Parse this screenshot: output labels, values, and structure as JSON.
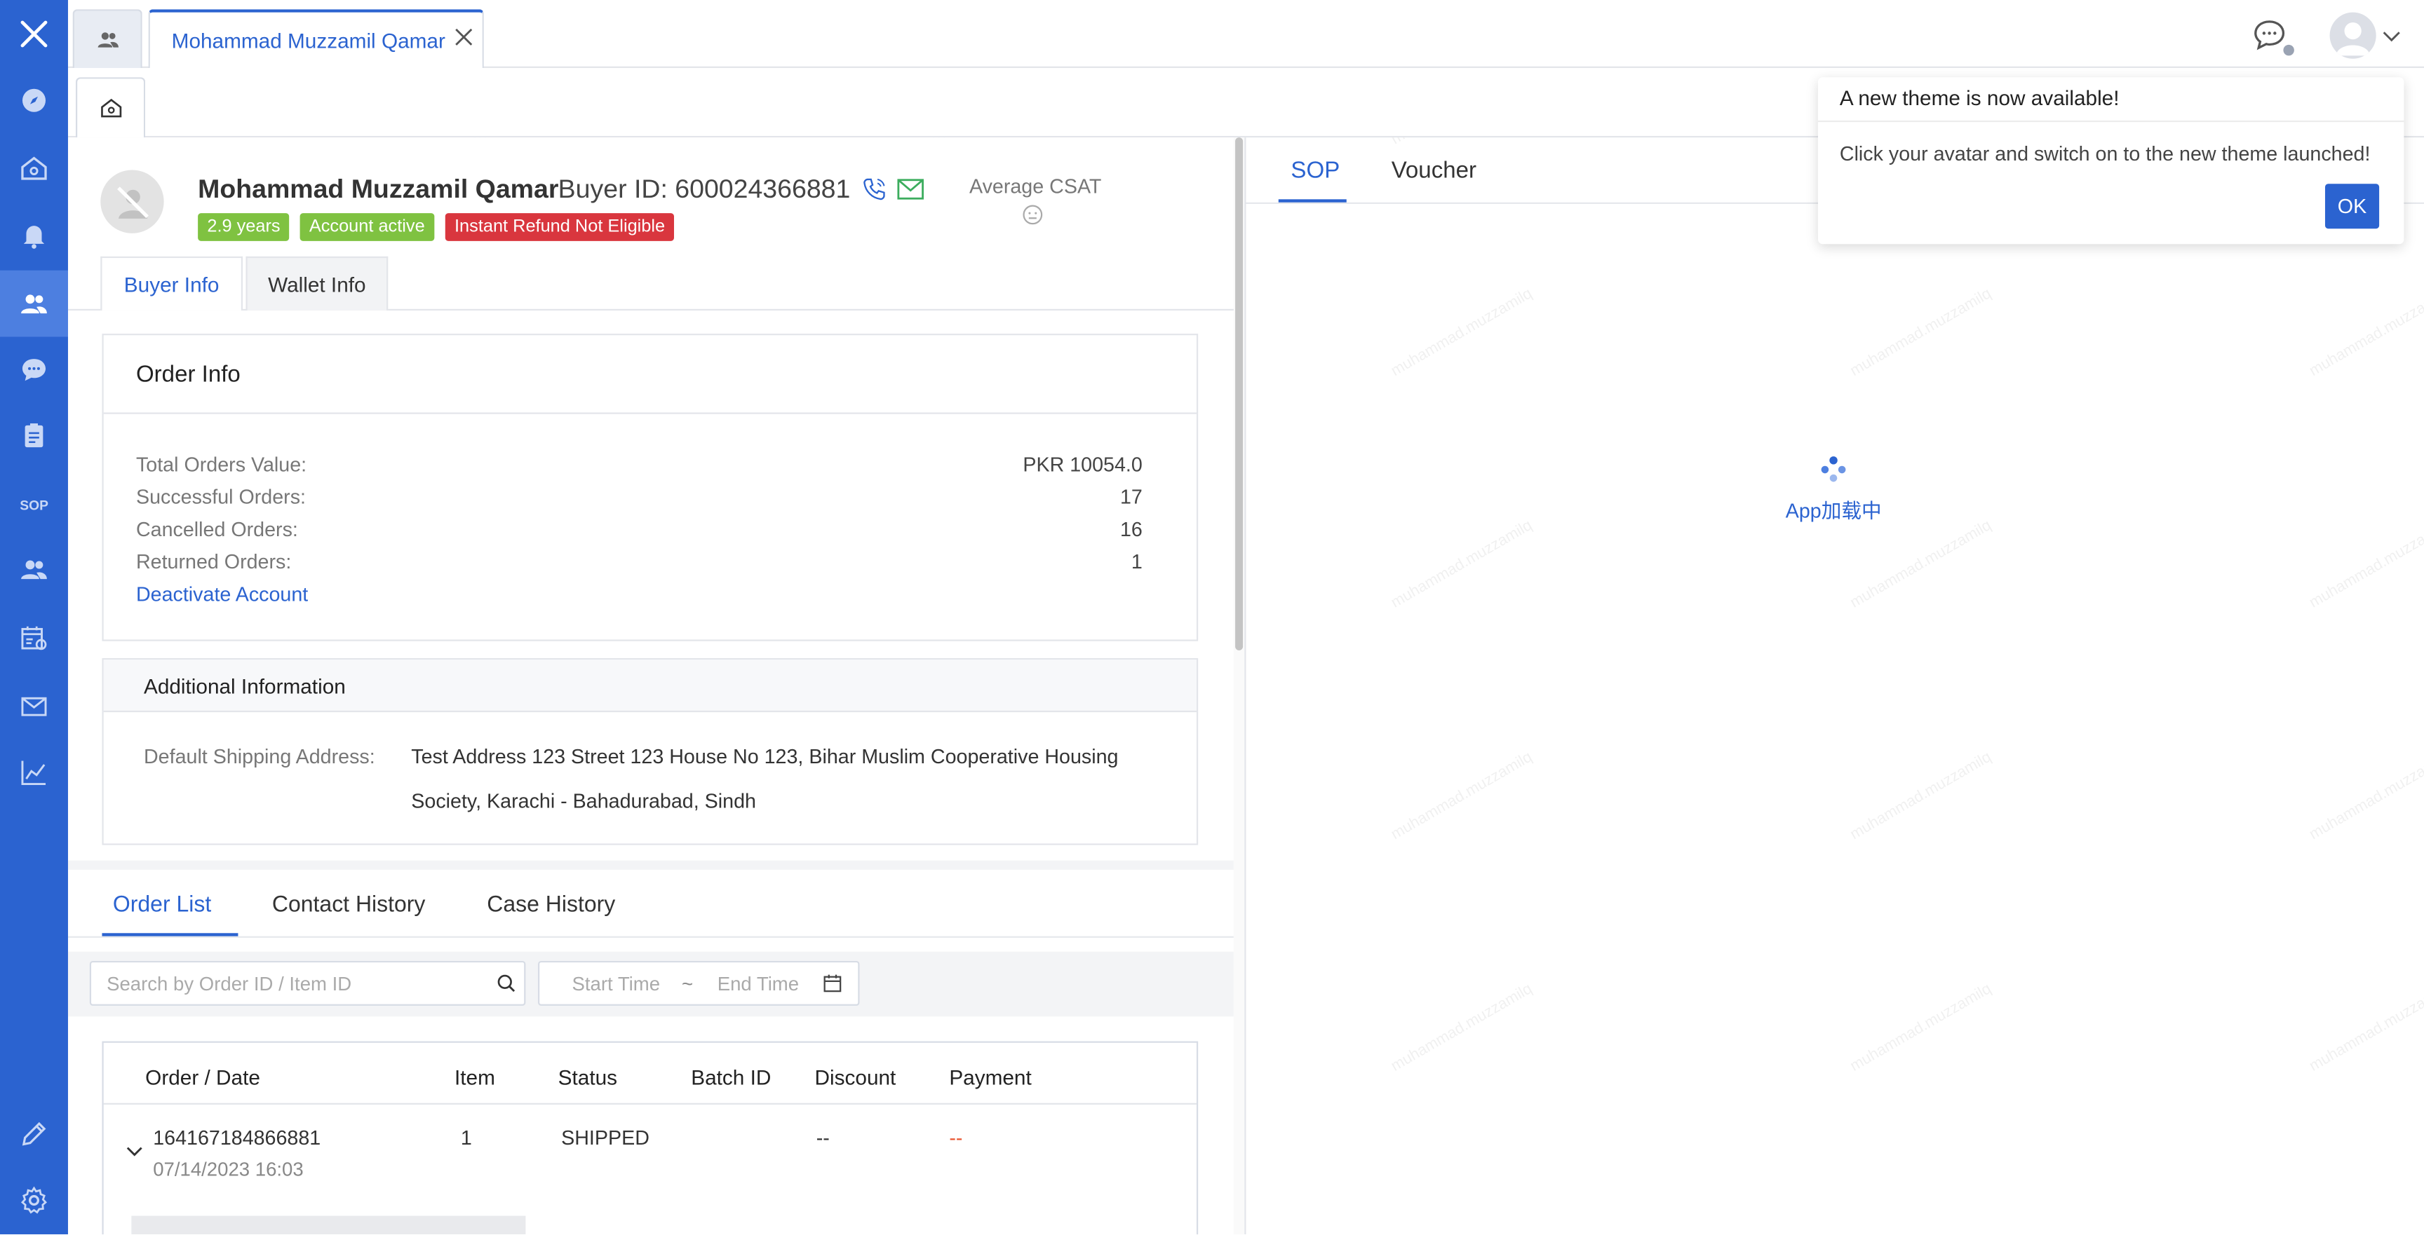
{
  "tabs": {
    "buyer_tab_label": "Mohammad Muzzamil Qamar",
    "buyer_tab_close": "X"
  },
  "profile": {
    "name": "Mohammad Muzzamil Qamar",
    "buyer_id": "Buyer ID: 600024366881",
    "csat_label": "Average CSAT",
    "badges": [
      "2.9 years",
      "Account active",
      "Instant Refund Not Eligible"
    ],
    "badge_colors": [
      "#7fc241",
      "#7fc241",
      "#d9363e"
    ]
  },
  "info_tabs": [
    "Buyer Info",
    "Wallet Info"
  ],
  "order_info": {
    "title": "Order Info",
    "rows": [
      {
        "label": "Total Orders Value:",
        "value": "PKR 10054.0"
      },
      {
        "label": "Successful Orders:",
        "value": "17"
      },
      {
        "label": "Cancelled Orders:",
        "value": "16"
      },
      {
        "label": "Returned Orders:",
        "value": "1"
      }
    ],
    "deactivate_link": "Deactivate Account"
  },
  "additional_info": {
    "title": "Additional Information",
    "address_label": "Default Shipping Address:",
    "address_line1": "Test Address 123 Street 123 House No 123, Bihar Muslim Cooperative Housing",
    "address_line2": "Society, Karachi - Bahadurabad, Sindh"
  },
  "order_tabs": [
    "Order List",
    "Contact History",
    "Case History"
  ],
  "search": {
    "placeholder": "Search by Order ID / Item ID",
    "start_time": "Start Time",
    "separator": "~",
    "end_time": "End Time"
  },
  "order_table": {
    "headers": [
      "Order / Date",
      "Item",
      "Status",
      "Batch ID",
      "Discount",
      "Payment"
    ],
    "rows": [
      {
        "order_id": "164167184866881",
        "date": "07/14/2023 16:03",
        "item": "1",
        "status": "SHIPPED",
        "batch_id": "",
        "discount": "--",
        "payment": "--"
      }
    ]
  },
  "right_tabs": [
    "SOP",
    "Voucher"
  ],
  "loading_text": "App加载中",
  "popover": {
    "title": "A new theme is now available!",
    "body": "Click your avatar and switch on to the new theme launched!",
    "ok_label": "OK"
  },
  "watermark": "muhammad.muzzamilq",
  "colors": {
    "primary": "#2b63d0",
    "sidebar": "#2b63d0",
    "payment_dash": "#e8542f"
  },
  "icons": {
    "sidebar": [
      "logo-icon",
      "compass-icon",
      "home-icon",
      "bell-icon",
      "users-icon",
      "chat-icon",
      "clipboard-icon",
      "sop-icon",
      "user-group-icon",
      "calendar-icon",
      "mail-icon",
      "chart-icon",
      "pencil-icon",
      "gear-icon"
    ]
  }
}
